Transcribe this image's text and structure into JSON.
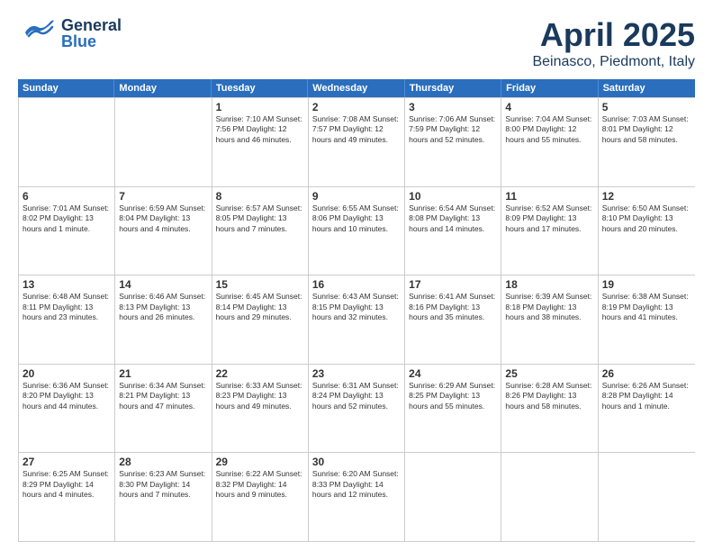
{
  "header": {
    "logo_general": "General",
    "logo_blue": "Blue",
    "month_title": "April 2025",
    "location": "Beinasco, Piedmont, Italy"
  },
  "days_of_week": [
    "Sunday",
    "Monday",
    "Tuesday",
    "Wednesday",
    "Thursday",
    "Friday",
    "Saturday"
  ],
  "rows": [
    [
      {
        "day": "",
        "info": ""
      },
      {
        "day": "",
        "info": ""
      },
      {
        "day": "1",
        "info": "Sunrise: 7:10 AM\nSunset: 7:56 PM\nDaylight: 12 hours\nand 46 minutes."
      },
      {
        "day": "2",
        "info": "Sunrise: 7:08 AM\nSunset: 7:57 PM\nDaylight: 12 hours\nand 49 minutes."
      },
      {
        "day": "3",
        "info": "Sunrise: 7:06 AM\nSunset: 7:59 PM\nDaylight: 12 hours\nand 52 minutes."
      },
      {
        "day": "4",
        "info": "Sunrise: 7:04 AM\nSunset: 8:00 PM\nDaylight: 12 hours\nand 55 minutes."
      },
      {
        "day": "5",
        "info": "Sunrise: 7:03 AM\nSunset: 8:01 PM\nDaylight: 12 hours\nand 58 minutes."
      }
    ],
    [
      {
        "day": "6",
        "info": "Sunrise: 7:01 AM\nSunset: 8:02 PM\nDaylight: 13 hours\nand 1 minute."
      },
      {
        "day": "7",
        "info": "Sunrise: 6:59 AM\nSunset: 8:04 PM\nDaylight: 13 hours\nand 4 minutes."
      },
      {
        "day": "8",
        "info": "Sunrise: 6:57 AM\nSunset: 8:05 PM\nDaylight: 13 hours\nand 7 minutes."
      },
      {
        "day": "9",
        "info": "Sunrise: 6:55 AM\nSunset: 8:06 PM\nDaylight: 13 hours\nand 10 minutes."
      },
      {
        "day": "10",
        "info": "Sunrise: 6:54 AM\nSunset: 8:08 PM\nDaylight: 13 hours\nand 14 minutes."
      },
      {
        "day": "11",
        "info": "Sunrise: 6:52 AM\nSunset: 8:09 PM\nDaylight: 13 hours\nand 17 minutes."
      },
      {
        "day": "12",
        "info": "Sunrise: 6:50 AM\nSunset: 8:10 PM\nDaylight: 13 hours\nand 20 minutes."
      }
    ],
    [
      {
        "day": "13",
        "info": "Sunrise: 6:48 AM\nSunset: 8:11 PM\nDaylight: 13 hours\nand 23 minutes."
      },
      {
        "day": "14",
        "info": "Sunrise: 6:46 AM\nSunset: 8:13 PM\nDaylight: 13 hours\nand 26 minutes."
      },
      {
        "day": "15",
        "info": "Sunrise: 6:45 AM\nSunset: 8:14 PM\nDaylight: 13 hours\nand 29 minutes."
      },
      {
        "day": "16",
        "info": "Sunrise: 6:43 AM\nSunset: 8:15 PM\nDaylight: 13 hours\nand 32 minutes."
      },
      {
        "day": "17",
        "info": "Sunrise: 6:41 AM\nSunset: 8:16 PM\nDaylight: 13 hours\nand 35 minutes."
      },
      {
        "day": "18",
        "info": "Sunrise: 6:39 AM\nSunset: 8:18 PM\nDaylight: 13 hours\nand 38 minutes."
      },
      {
        "day": "19",
        "info": "Sunrise: 6:38 AM\nSunset: 8:19 PM\nDaylight: 13 hours\nand 41 minutes."
      }
    ],
    [
      {
        "day": "20",
        "info": "Sunrise: 6:36 AM\nSunset: 8:20 PM\nDaylight: 13 hours\nand 44 minutes."
      },
      {
        "day": "21",
        "info": "Sunrise: 6:34 AM\nSunset: 8:21 PM\nDaylight: 13 hours\nand 47 minutes."
      },
      {
        "day": "22",
        "info": "Sunrise: 6:33 AM\nSunset: 8:23 PM\nDaylight: 13 hours\nand 49 minutes."
      },
      {
        "day": "23",
        "info": "Sunrise: 6:31 AM\nSunset: 8:24 PM\nDaylight: 13 hours\nand 52 minutes."
      },
      {
        "day": "24",
        "info": "Sunrise: 6:29 AM\nSunset: 8:25 PM\nDaylight: 13 hours\nand 55 minutes."
      },
      {
        "day": "25",
        "info": "Sunrise: 6:28 AM\nSunset: 8:26 PM\nDaylight: 13 hours\nand 58 minutes."
      },
      {
        "day": "26",
        "info": "Sunrise: 6:26 AM\nSunset: 8:28 PM\nDaylight: 14 hours\nand 1 minute."
      }
    ],
    [
      {
        "day": "27",
        "info": "Sunrise: 6:25 AM\nSunset: 8:29 PM\nDaylight: 14 hours\nand 4 minutes."
      },
      {
        "day": "28",
        "info": "Sunrise: 6:23 AM\nSunset: 8:30 PM\nDaylight: 14 hours\nand 7 minutes."
      },
      {
        "day": "29",
        "info": "Sunrise: 6:22 AM\nSunset: 8:32 PM\nDaylight: 14 hours\nand 9 minutes."
      },
      {
        "day": "30",
        "info": "Sunrise: 6:20 AM\nSunset: 8:33 PM\nDaylight: 14 hours\nand 12 minutes."
      },
      {
        "day": "",
        "info": ""
      },
      {
        "day": "",
        "info": ""
      },
      {
        "day": "",
        "info": ""
      }
    ]
  ]
}
